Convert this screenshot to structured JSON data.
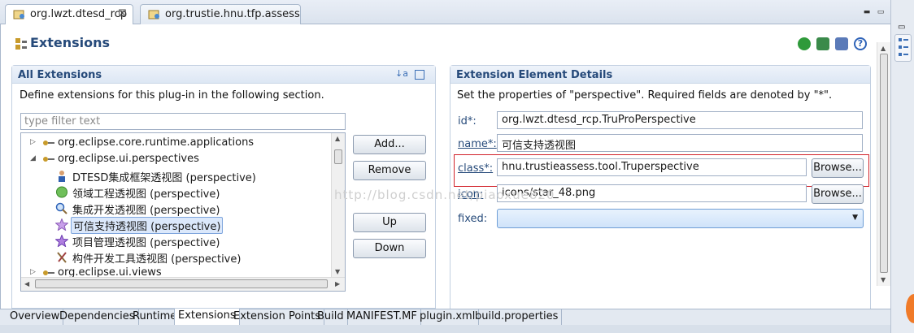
{
  "editor_tabs": [
    {
      "label": "org.lwzt.dtesd_rcp",
      "close": "⊠"
    },
    {
      "label": "org.trustie.hnu.tfp.assess"
    }
  ],
  "page": {
    "title": "Extensions"
  },
  "all_extensions": {
    "title": "All Extensions",
    "description": "Define extensions for this plug-in in the following section.",
    "filter_placeholder": "type filter text",
    "tree": [
      {
        "label": "org.eclipse.core.runtime.applications",
        "twisty": "▷"
      },
      {
        "label": "org.eclipse.ui.perspectives",
        "twisty": "◢"
      },
      {
        "label": "DTESD集成框架透视图 (perspective)"
      },
      {
        "label": "领域工程透视图 (perspective)"
      },
      {
        "label": "集成开发透视图 (perspective)"
      },
      {
        "label": "可信支持透视图 (perspective)"
      },
      {
        "label": "项目管理透视图 (perspective)"
      },
      {
        "label": "构件开发工具透视图 (perspective)"
      },
      {
        "label": "org.eclipse.ui.views",
        "twisty": "▷"
      }
    ],
    "buttons": {
      "add": "Add...",
      "remove": "Remove",
      "up": "Up",
      "down": "Down"
    }
  },
  "details": {
    "title": "Extension Element Details",
    "description": "Set the properties of \"perspective\". Required fields are denoted by \"*\".",
    "fields": {
      "id_label": "id*:",
      "id_value": "org.lwzt.dtesd_rcp.TruProPerspective",
      "name_label": "name*:",
      "name_value": "可信支持透视图",
      "class_label": "class*:",
      "class_value": "hnu.trustieassess.tool.Truperspective",
      "icon_label": "icon:",
      "icon_value": "icons/star_48.png",
      "fixed_label": "fixed:",
      "fixed_value": ""
    },
    "browse": "Browse..."
  },
  "watermark": "http://blog.csdn.net/piaoxue820",
  "page_tabs": [
    "Overview",
    "Dependencies",
    "Runtime",
    "Extensions",
    "Extension Points",
    "Build",
    "MANIFEST.MF",
    "plugin.xml",
    "build.properties"
  ],
  "active_page_tab": "Extensions",
  "colors": {
    "accent": "#264a7a",
    "highlight": "#d2232a",
    "selection": "#dbe8fb"
  }
}
